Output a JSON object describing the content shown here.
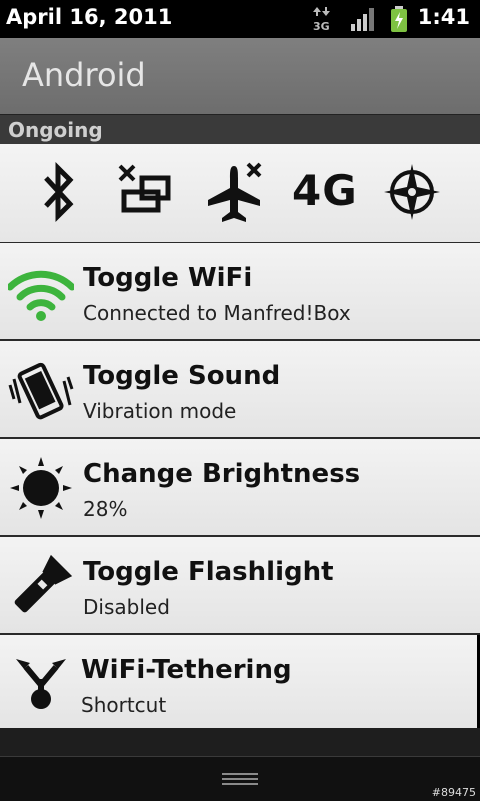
{
  "status_bar": {
    "date": "April 16, 2011",
    "time": "1:41",
    "network_label": "3G",
    "icons": [
      "data-arrows-icon",
      "signal-bars-icon",
      "battery-charging-icon"
    ]
  },
  "app_bar": {
    "title": "Android"
  },
  "section": {
    "title": "Ongoing"
  },
  "quick_toggles": {
    "items": [
      {
        "name": "bluetooth-icon"
      },
      {
        "name": "auto-rotate-off-icon"
      },
      {
        "name": "airplane-mode-off-icon"
      },
      {
        "name": "4g-toggle",
        "label": "4G"
      },
      {
        "name": "gps-icon"
      }
    ]
  },
  "rows": [
    {
      "title": "Toggle WiFi",
      "subtitle": "Connected to Manfred!Box",
      "icon": "wifi-icon",
      "icon_color": "#3db43d"
    },
    {
      "title": "Toggle Sound",
      "subtitle": "Vibration mode",
      "icon": "vibrate-phone-icon"
    },
    {
      "title": "Change Brightness",
      "subtitle": "28%",
      "icon": "brightness-sun-icon"
    },
    {
      "title": "Toggle Flashlight",
      "subtitle": "Disabled",
      "icon": "flashlight-icon"
    },
    {
      "title": "WiFi-Tethering",
      "subtitle": "Shortcut",
      "icon": "tethering-icon"
    }
  ],
  "footer": {
    "tag": "#89475"
  },
  "colors": {
    "accent_wifi": "#3db43d",
    "panel_bg": "#ececec",
    "battery": "#7ec242"
  }
}
